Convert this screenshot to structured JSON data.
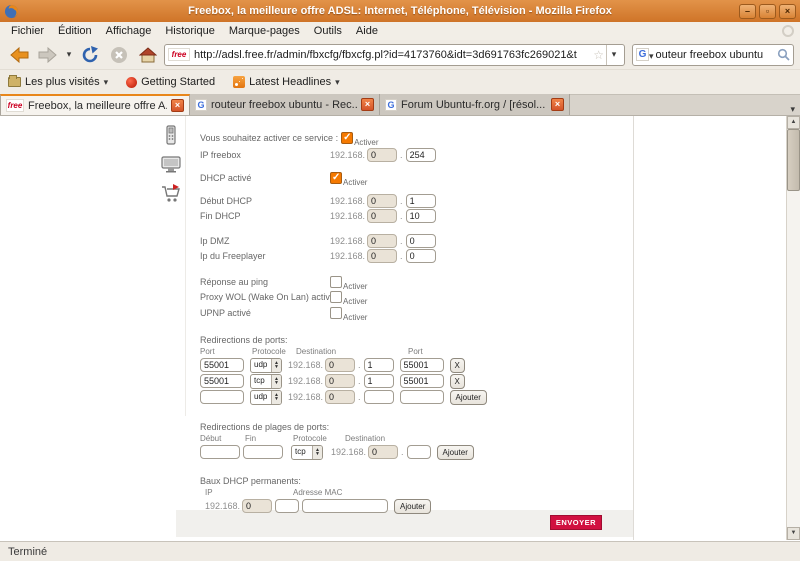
{
  "titlebar": {
    "title": "Freebox, la meilleure offre ADSL: Internet, Téléphone, Télévision - Mozilla Firefox"
  },
  "menubar": {
    "items": [
      "Fichier",
      "Édition",
      "Affichage",
      "Historique",
      "Marque-pages",
      "Outils",
      "Aide"
    ]
  },
  "navbar": {
    "url": "http://adsl.free.fr/admin/fbxcfg/fbxcfg.pl?id=4173760&idt=3d691763fc269021&t",
    "search_value": "outeur freebox ubuntu"
  },
  "branding": {
    "free": "free",
    "google": "G"
  },
  "bookmarks": {
    "most_visited": "Les plus visités",
    "getting_started": "Getting Started",
    "latest_headlines": "Latest Headlines"
  },
  "tabs": [
    {
      "label": "Freebox, la meilleure offre A..."
    },
    {
      "label": "routeur freebox ubuntu - Rec..."
    },
    {
      "label": "Forum Ubuntu-fr.org / [résol..."
    }
  ],
  "form": {
    "ip_prefix": "192.168.",
    "dot": ".",
    "activer": "Activer",
    "service_label": "Vous souhaitez activer ce service :",
    "service_checked": true,
    "ip_freebox": {
      "label": "IP freebox",
      "octet3": "0",
      "octet4": "254"
    },
    "dhcp_enabled_label": "DHCP activé",
    "dhcp_checked": true,
    "dhcp_start": {
      "label": "Début DHCP",
      "octet3": "0",
      "octet4": "1"
    },
    "dhcp_end": {
      "label": "Fin DHCP",
      "octet3": "0",
      "octet4": "10"
    },
    "dmz": {
      "label": "Ip DMZ",
      "octet3": "0",
      "octet4": "0"
    },
    "freeplayer": {
      "label": "Ip du Freeplayer",
      "octet3": "0",
      "octet4": "0"
    },
    "ping_label": "Réponse au ping",
    "ping_checked": false,
    "wol_label": "Proxy WOL (Wake On Lan) activé",
    "wol_checked": false,
    "upnp_label": "UPNP activé",
    "upnp_checked": false,
    "port_redirects": {
      "title": "Redirections de ports:",
      "headers": [
        "Port",
        "Protocole",
        "Destination",
        "Port"
      ],
      "rows": [
        {
          "port": "55001",
          "proto": "udp",
          "octet3": "0",
          "octet4": "1",
          "dest_port": "55001",
          "action": "X"
        },
        {
          "port": "55001",
          "proto": "tcp",
          "octet3": "0",
          "octet4": "1",
          "dest_port": "55001",
          "action": "X"
        },
        {
          "port": "",
          "proto": "udp",
          "octet3": "0",
          "octet4": "",
          "dest_port": "",
          "action": "Ajouter"
        }
      ]
    },
    "range_redirects": {
      "title": "Redirections de plages de ports:",
      "headers": [
        "Début",
        "Fin",
        "Protocole",
        "Destination"
      ],
      "row": {
        "start": "",
        "end": "",
        "proto": "tcp",
        "octet3": "0",
        "octet4": "",
        "action": "Ajouter"
      }
    },
    "dhcp_leases": {
      "title": "Baux DHCP permanents:",
      "headers": [
        "IP",
        "Adresse MAC"
      ],
      "row": {
        "octet3": "0",
        "octet4": "",
        "mac": "",
        "action": "Ajouter"
      }
    },
    "submit": "ENVOYER"
  },
  "statusbar": {
    "text": "Terminé"
  }
}
